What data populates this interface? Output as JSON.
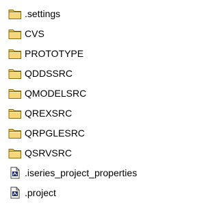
{
  "colors": {
    "folder_fill": "#F5D77A",
    "folder_tab": "#E8BF4D",
    "folder_outline": "#8C6A12",
    "file_fill": "#FFFFFF",
    "file_outline": "#404040",
    "file_glyph": "#1E2A6E"
  },
  "tree": {
    "items": [
      {
        "label": ".settings",
        "icon": "folder-icon",
        "type": "folder"
      },
      {
        "label": "CVS",
        "icon": "folder-icon",
        "type": "folder"
      },
      {
        "label": "PROTOTYPE",
        "icon": "folder-icon",
        "type": "folder"
      },
      {
        "label": "QDDSSRC",
        "icon": "folder-icon",
        "type": "folder"
      },
      {
        "label": "QMODELSRC",
        "icon": "folder-icon",
        "type": "folder"
      },
      {
        "label": "QREXSRC",
        "icon": "folder-icon",
        "type": "folder"
      },
      {
        "label": "QRPGLESRC",
        "icon": "folder-icon",
        "type": "folder"
      },
      {
        "label": "QSRVSRC",
        "icon": "folder-icon",
        "type": "folder"
      },
      {
        "label": ".iseries_project_properties",
        "icon": "file-icon",
        "type": "file"
      },
      {
        "label": ".project",
        "icon": "file-icon",
        "type": "file"
      }
    ]
  }
}
